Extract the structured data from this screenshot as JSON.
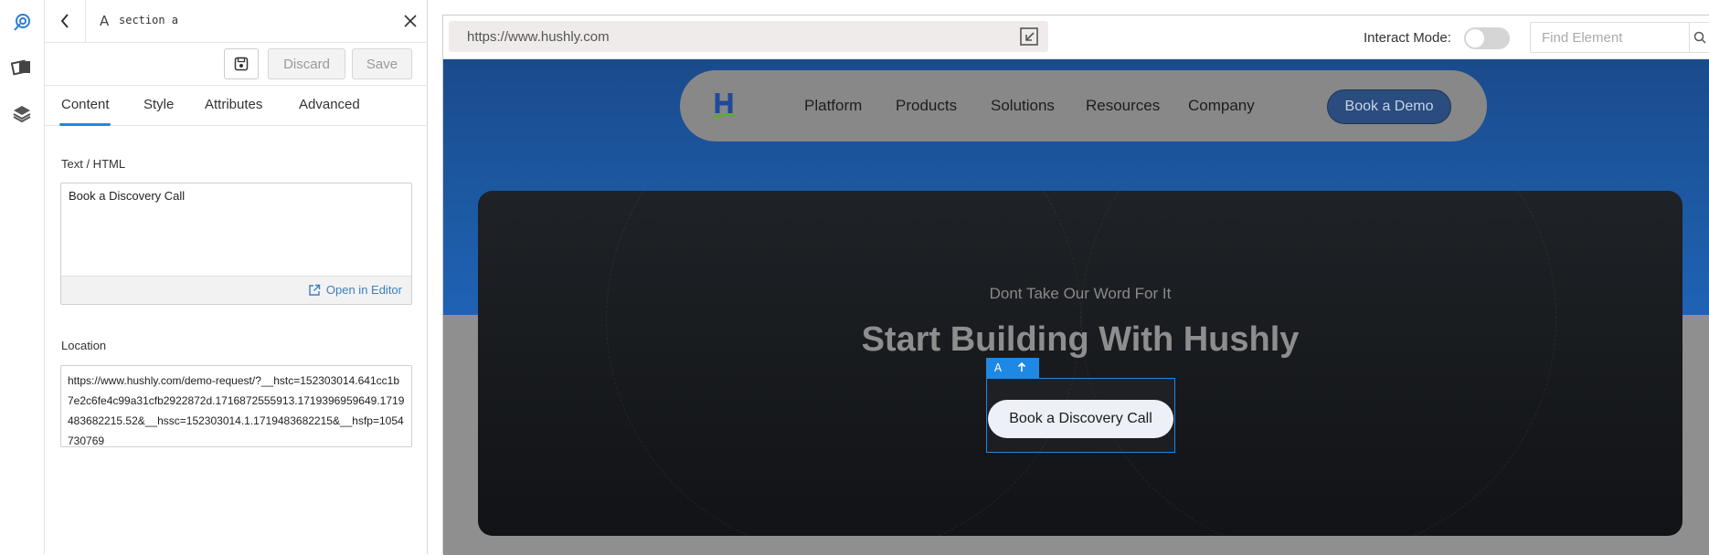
{
  "rail": {
    "icons": [
      "target-select-icon",
      "pages-icon",
      "layers-icon"
    ]
  },
  "panel": {
    "element_letter": "A",
    "element_name": "section a",
    "toolbar": {
      "discard_label": "Discard",
      "save_label": "Save"
    },
    "tabs": [
      {
        "label": "Content"
      },
      {
        "label": "Style"
      },
      {
        "label": "Attributes"
      },
      {
        "label": "Advanced"
      }
    ],
    "active_tab": "Content",
    "text_label": "Text / HTML",
    "text_value": "Book a Discovery Call",
    "open_editor_label": "Open in Editor",
    "location_label": "Location",
    "location_value": "https://www.hushly.com/demo-request/?__hstc=152303014.641cc1b7e2c6fe4c99a31cfb2922872d.1716872555913.1719396959649.1719483682215.52&__hssc=152303014.1.1719483682215&__hsfp=1054730769"
  },
  "browser": {
    "url": "https://www.hushly.com",
    "interact_mode_label": "Interact Mode:",
    "interact_mode_on": false,
    "find_placeholder": "Find Element"
  },
  "site": {
    "nav": {
      "items": [
        "Platform",
        "Products",
        "Solutions",
        "Resources",
        "Company"
      ],
      "cta": "Book a Demo"
    },
    "hero": {
      "subtitle": "Dont Take Our Word For It",
      "title": "Start Building With Hushly",
      "cta": "Book a Discovery Call"
    },
    "selection_tag": {
      "letter": "A",
      "icon": "arrow-up-icon"
    }
  },
  "colors": {
    "accent": "#1e88e5",
    "site_blue": "#1d5aa4",
    "hero_dark": "#16191c"
  }
}
